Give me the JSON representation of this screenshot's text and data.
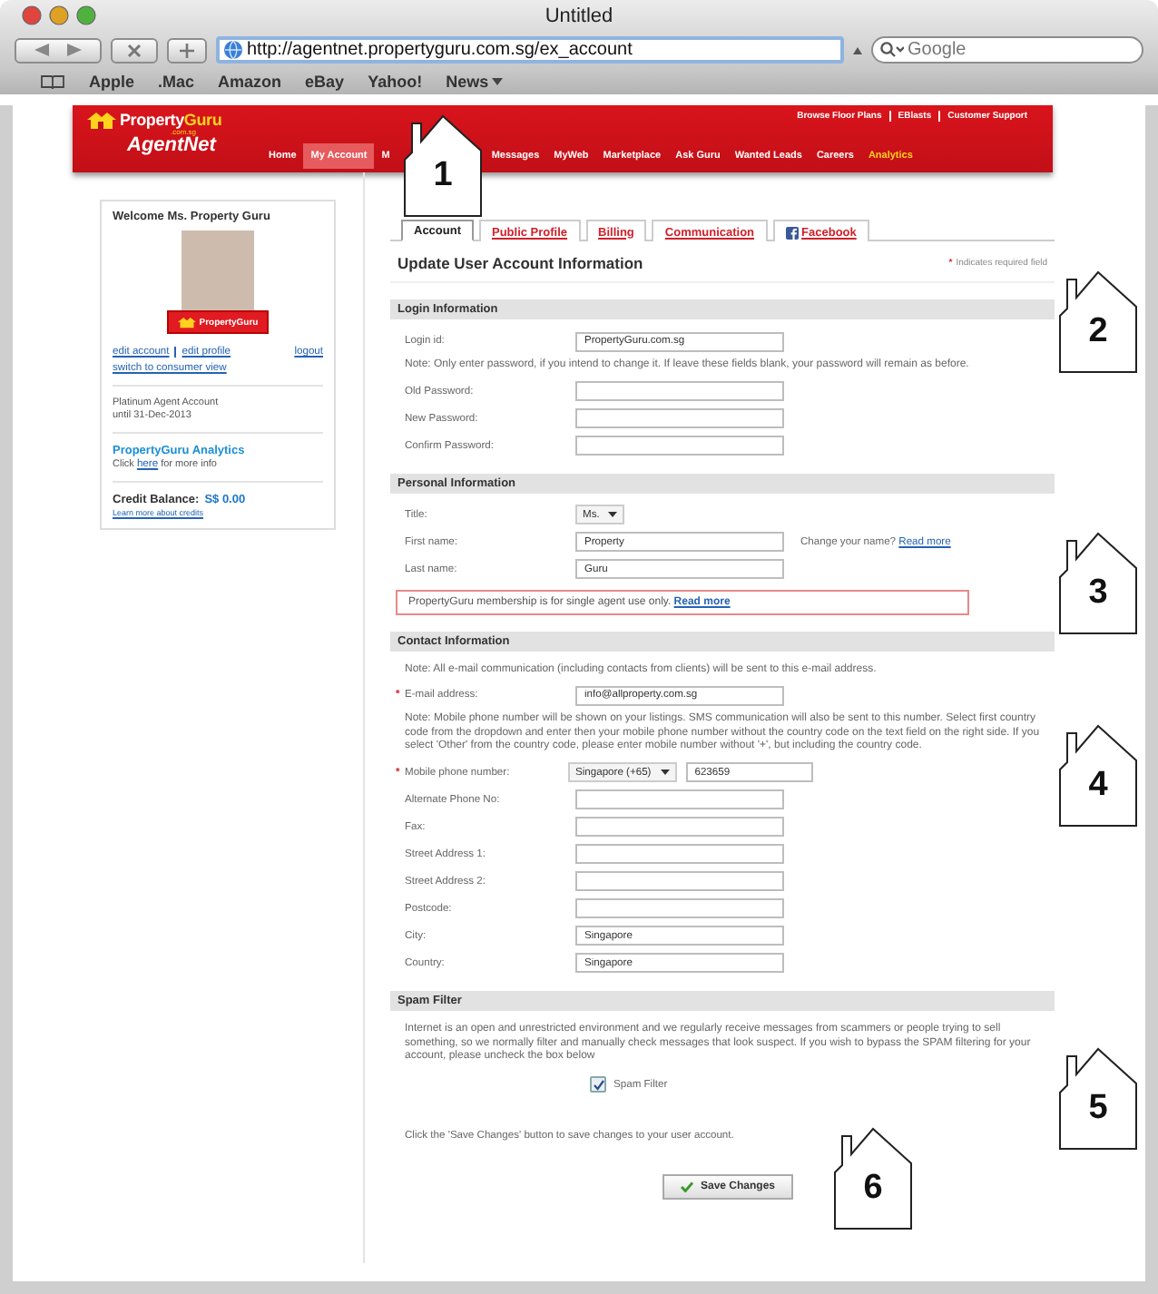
{
  "window": {
    "title": "Untitled"
  },
  "toolbar": {
    "url": "http://agentnet.propertyguru.com.sg/ex_account",
    "search_placeholder": "Google"
  },
  "bookmarks": [
    {
      "label": "Apple",
      "menu": false
    },
    {
      "label": ".Mac",
      "menu": false
    },
    {
      "label": "Amazon",
      "menu": false
    },
    {
      "label": "eBay",
      "menu": false
    },
    {
      "label": "Yahoo!",
      "menu": false
    },
    {
      "label": "News",
      "menu": true
    }
  ],
  "site_header": {
    "logo": {
      "first": "Property",
      "second": "Guru",
      "domain": ".com.sg",
      "product": "AgentNet"
    },
    "top_links": [
      "Browse Floor Plans",
      "EBlasts",
      "Customer Support"
    ],
    "nav": [
      {
        "label": "Home",
        "selected": false,
        "highlight": false
      },
      {
        "label": "My Account",
        "selected": true,
        "highlight": false
      },
      {
        "label": "M",
        "selected": false,
        "highlight": false
      },
      {
        "label": "Messages",
        "selected": false,
        "highlight": false
      },
      {
        "label": "MyWeb",
        "selected": false,
        "highlight": false
      },
      {
        "label": "Marketplace",
        "selected": false,
        "highlight": false
      },
      {
        "label": "Ask Guru",
        "selected": false,
        "highlight": false
      },
      {
        "label": "Wanted Leads",
        "selected": false,
        "highlight": false
      },
      {
        "label": "Careers",
        "selected": false,
        "highlight": false
      },
      {
        "label": "Analytics",
        "selected": false,
        "highlight": true
      }
    ]
  },
  "sidebar": {
    "welcome": "Welcome Ms. Property Guru",
    "badge": "PropertyGuru",
    "account_links": [
      "edit account",
      "edit profile"
    ],
    "logout": "logout",
    "consumer_link": "switch to consumer view",
    "plan": [
      "Platinum Agent Account",
      "until 31-Dec-2013"
    ],
    "analytics": {
      "title": "PropertyGuru Analytics",
      "text_before": "Click",
      "link": "here",
      "text_after": "for more info"
    },
    "credit": {
      "label": "Credit Balance:",
      "amount": "S$ 0.00",
      "link": "Learn more about credits"
    }
  },
  "form": {
    "tabs": [
      {
        "label": "Account",
        "selected": true,
        "kind": "plain"
      },
      {
        "label": "Public Profile",
        "selected": false,
        "kind": "plain"
      },
      {
        "label": "Billing",
        "selected": false,
        "kind": "plain"
      },
      {
        "label": "Communication",
        "selected": false,
        "kind": "plain"
      },
      {
        "label": "Facebook",
        "selected": false,
        "kind": "social"
      }
    ],
    "heading": "Update User Account Information",
    "required_mark": "*",
    "required_note": "Indicates required field",
    "sections": [
      {
        "title": "Login Information",
        "rows": [
          {
            "kind": "field",
            "label": "Login id:",
            "value": "PropertyGuru.com.sg",
            "required": false
          },
          {
            "kind": "note",
            "text": "Note: Only enter password, if you intend to change it. If leave these fields blank, your password will remain as before."
          },
          {
            "kind": "field",
            "label": "Old Password:",
            "required": false
          },
          {
            "kind": "field",
            "label": "New Password:",
            "required": false
          },
          {
            "kind": "field",
            "label": "Confirm Password:",
            "required": false
          }
        ]
      },
      {
        "title": "Personal Information",
        "rows": [
          {
            "kind": "select",
            "label": "Title:",
            "value": "Ms."
          },
          {
            "kind": "field",
            "label": "First name:",
            "value": "Property",
            "required": false,
            "aside": "Change your name?",
            "aside_link": "Read more"
          },
          {
            "kind": "field",
            "label": "Last name:",
            "value": "Guru",
            "required": false
          },
          {
            "kind": "alert",
            "text": "PropertyGuru membership is for single agent use only.",
            "link": "Read more"
          }
        ]
      },
      {
        "title": "Contact Information",
        "rows": [
          {
            "kind": "note",
            "text": "Note: All e-mail communication (including contacts from clients) will be sent to this e-mail address."
          },
          {
            "kind": "field",
            "label": "E-mail address:",
            "value": "info@allproperty.com.sg",
            "required": true
          },
          {
            "kind": "note",
            "text": "Note: Mobile phone number will be shown on your listings. SMS communication will also be sent to this number. Select first country code from the dropdown and enter then your mobile phone number without the country code on the text field on the right side. If you select 'Other' from the country code, please enter mobile number without '+', but including the country code."
          },
          {
            "kind": "phone",
            "label": "Mobile phone number:",
            "country": "Singapore (+65)",
            "value": "623659",
            "required": true
          },
          {
            "kind": "field",
            "label": "Alternate Phone No:",
            "required": false
          },
          {
            "kind": "field",
            "label": "Fax:",
            "required": false
          },
          {
            "kind": "field",
            "label": "Street Address 1:",
            "required": false
          },
          {
            "kind": "field",
            "label": "Street Address 2:",
            "required": false
          },
          {
            "kind": "field",
            "label": "Postcode:",
            "required": false
          },
          {
            "kind": "field",
            "label": "City:",
            "value": "Singapore",
            "required": false
          },
          {
            "kind": "field",
            "label": "Country:",
            "value": "Singapore",
            "required": false
          }
        ]
      },
      {
        "title": "Spam Filter",
        "rows": [
          {
            "kind": "note",
            "text": "Internet is an open and unrestricted environment and we regularly receive messages from scammers or people trying to sell something, so we normally filter and manually check messages that look suspect. If you wish to bypass the SPAM filtering for your account, please uncheck the box below"
          },
          {
            "kind": "checkbox",
            "label": "Spam Filter",
            "checked": true
          }
        ]
      }
    ],
    "footer_note": "Click the 'Save Changes' button to save changes to your user account.",
    "save_button": "Save Changes"
  },
  "callouts": [
    "1",
    "2",
    "3",
    "4",
    "5",
    "6"
  ]
}
